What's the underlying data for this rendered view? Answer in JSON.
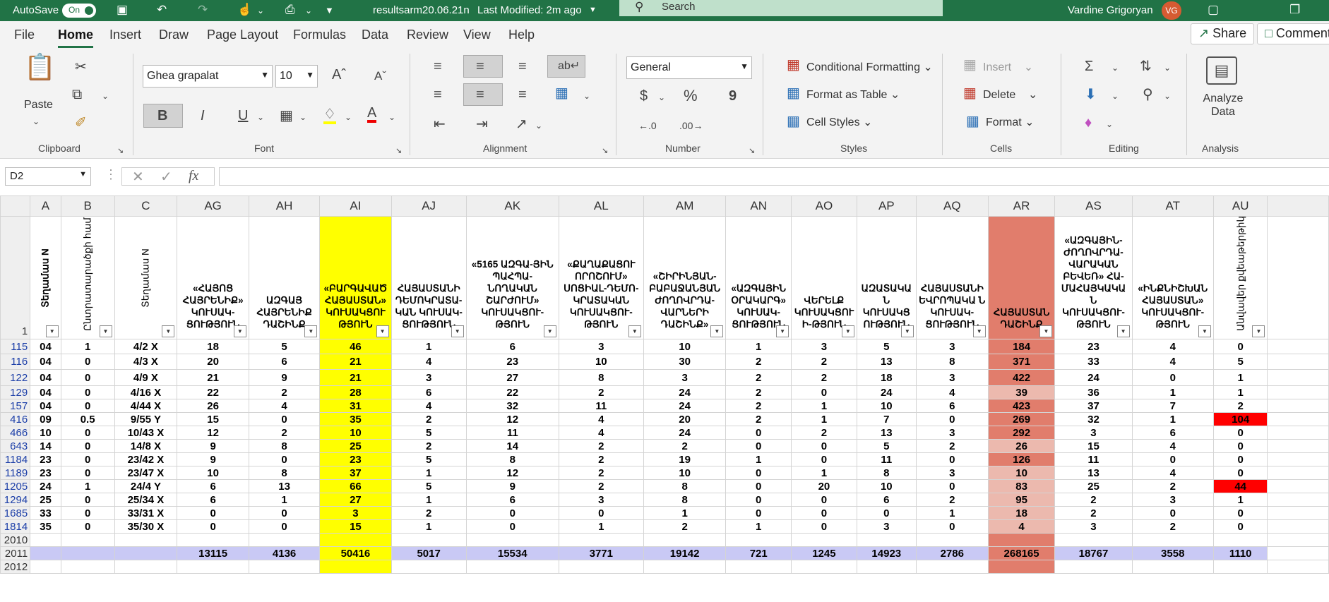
{
  "titlebar": {
    "autosave_label": "AutoSave",
    "toggle_label": "On",
    "filename": "resultsarm20.06.21n",
    "modified": "Last Modified: 2m ago",
    "search_placeholder": "Search",
    "user_name": "Vardine Grigoryan",
    "user_initials": "VG"
  },
  "menu": {
    "tabs": [
      "File",
      "Home",
      "Insert",
      "Draw",
      "Page Layout",
      "Formulas",
      "Data",
      "Review",
      "View",
      "Help"
    ],
    "share": "Share",
    "comments": "Comments"
  },
  "ribbon": {
    "clipboard": {
      "label": "Clipboard",
      "paste": "Paste"
    },
    "font": {
      "label": "Font",
      "name": "Ghea grapalat",
      "size": "10",
      "bold": "B",
      "italic": "I",
      "underline": "U"
    },
    "alignment": {
      "label": "Alignment"
    },
    "number": {
      "label": "Number",
      "format": "General",
      "currency": "$",
      "percent": "%",
      "comma": "9"
    },
    "styles": {
      "label": "Styles",
      "conditional": "Conditional Formatting",
      "table": "Format as Table",
      "cell": "Cell Styles"
    },
    "cells": {
      "label": "Cells",
      "insert": "Insert",
      "delete": "Delete",
      "format": "Format"
    },
    "editing": {
      "label": "Editing"
    },
    "analysis": {
      "label": "Analysis",
      "analyze": "Analyze Data"
    }
  },
  "formula_bar": {
    "name_box": "D2",
    "fx": "fx",
    "value": ""
  },
  "sheet": {
    "columns": [
      "A",
      "B",
      "C",
      "AG",
      "AH",
      "AI",
      "AJ",
      "AK",
      "AL",
      "AM",
      "AN",
      "AO",
      "AP",
      "AQ",
      "AR",
      "AS",
      "AT",
      "AU"
    ],
    "header_row_number": "1",
    "headers": [
      "Տեղամաս N",
      "Ընտրատարածքի համարը",
      "Տեղամաս N",
      "«ՀԱՅՈՑ ՀԱՅՐԵՆԻՔ» ԿՈՒՍԱԿ-ՑՈՒԹՅՈՒՆ",
      "ԱԶԳԱՅ ՀԱՅՐԵՆԻՔ ԴԱՇԻՆՔ",
      "«ԲԱՐԳԱՎԱԾ ՀԱՅԱՍՏԱՆ» ԿՈՒՍԱԿՑՈՒ ԹՅՈՒՆ",
      "ՀԱՅԱՍՏԱՆԻ ԴԵՄՈԿՐԱՏԱ-ԿԱՆ ԿՈՒՍԱԿ-ՑՈՒԹՅՈՒՆ",
      "«5165 ԱԶԳԱ-ՅԻՆ ՊԱՀՊԱ-ՆՈՂԱԿԱՆ ՇԱՐԺՈՒՄ» ԿՈՒՍԱԿՑՈՒ-ԹՅՈՒՆ",
      "«ՔԱՂԱՔԱՑՈՒ ՈՐՈՇՈՒՄ» ՍՈՑԻԱԼ-ԴԵՄՈ-ԿՐԱՏԱԿԱՆ ԿՈՒՍԱԿՑՈՒ-ԹՅՈՒՆ",
      "«ՇԻՐԻՆՅԱՆ-ԲԱԲԱՋԱՆՅԱՆ ԺՈՂՈՎՐԴԱ-ՎԱՐՆԵՐԻ ԴԱՇԻՆՔ»",
      "«ԱԶԳԱՅԻՆ ՕՐԱԿԱՐԳ» ԿՈՒՍԱԿ-ՑՈՒԹՅՈՒՆ",
      "ՎԵՐԵԼՔ ԿՈՒՍԱԿՑՈՒ Ի-ԹՅՈՒՆ",
      "ԱԶԱՏԱԿԱ Ն ԿՈՒՍԱԿՑ ՈՒԹՅՈՒՆ",
      "ՀԱՅԱՍՏԱՆԻ ԵՎՐՈՊԱԿԱ Ն ԿՈՒՍԱԿ-ՑՈՒԹՅՈՒՆ",
      "ՀԱՅԱՍՏԱՆ ԴԱՇԻՆՔ",
      "«ԱԶԳԱՅԻՆ-ԺՈՂՈՎՐԴԱ-ՎԱՐԱԿԱՆ ԲԵՎԵՌ» ՀԱ-ՄԱՀԱՅԿԱԿԱ Ն ԿՈՒՍԱԿՑՈՒ-ԹՅՈՒՆ",
      "«ԻՆՔՆԻՇԽԱՆ ՀԱՅԱՍՏԱՆ» ԿՈՒՍԱԿՑՈՒ-ԹՅՈՒՆ",
      "Անվավեր քվեաթերթիկներ"
    ],
    "rows": [
      {
        "n": "115",
        "c": [
          "04",
          "1",
          "4/2 X",
          "18",
          "5",
          "46",
          "1",
          "6",
          "3",
          "10",
          "1",
          "3",
          "5",
          "3",
          "184",
          "23",
          "4",
          "0"
        ]
      },
      {
        "n": "116",
        "c": [
          "04",
          "0",
          "4/3 X",
          "20",
          "6",
          "21",
          "4",
          "23",
          "10",
          "30",
          "2",
          "2",
          "13",
          "8",
          "371",
          "33",
          "4",
          "5"
        ]
      },
      {
        "n": "122",
        "c": [
          "04",
          "0",
          "4/9 X",
          "21",
          "9",
          "21",
          "3",
          "27",
          "8",
          "3",
          "2",
          "2",
          "18",
          "3",
          "422",
          "24",
          "0",
          "1"
        ]
      },
      {
        "n": "129",
        "c": [
          "04",
          "0",
          "4/16 X",
          "22",
          "2",
          "28",
          "6",
          "22",
          "2",
          "24",
          "2",
          "0",
          "24",
          "4",
          "39",
          "36",
          "1",
          "1"
        ]
      },
      {
        "n": "157",
        "c": [
          "04",
          "0",
          "4/44 X",
          "26",
          "4",
          "31",
          "4",
          "32",
          "11",
          "24",
          "2",
          "1",
          "10",
          "6",
          "423",
          "37",
          "7",
          "2"
        ]
      },
      {
        "n": "416",
        "c": [
          "09",
          "0.5",
          "9/55 Y",
          "15",
          "0",
          "35",
          "2",
          "12",
          "4",
          "20",
          "2",
          "1",
          "7",
          "0",
          "269",
          "32",
          "1",
          "104"
        ]
      },
      {
        "n": "466",
        "c": [
          "10",
          "0",
          "10/43 X",
          "12",
          "2",
          "10",
          "5",
          "11",
          "4",
          "24",
          "0",
          "2",
          "13",
          "3",
          "292",
          "3",
          "6",
          "0"
        ]
      },
      {
        "n": "643",
        "c": [
          "14",
          "0",
          "14/8 X",
          "9",
          "8",
          "25",
          "2",
          "14",
          "2",
          "2",
          "0",
          "0",
          "5",
          "2",
          "26",
          "15",
          "4",
          "0"
        ]
      },
      {
        "n": "1184",
        "c": [
          "23",
          "0",
          "23/42 X",
          "9",
          "0",
          "23",
          "5",
          "8",
          "2",
          "19",
          "1",
          "0",
          "11",
          "0",
          "126",
          "11",
          "0",
          "0"
        ]
      },
      {
        "n": "1189",
        "c": [
          "23",
          "0",
          "23/47 X",
          "10",
          "8",
          "37",
          "1",
          "12",
          "2",
          "10",
          "0",
          "1",
          "8",
          "3",
          "10",
          "13",
          "4",
          "0"
        ]
      },
      {
        "n": "1205",
        "c": [
          "24",
          "1",
          "24/4 Y",
          "6",
          "13",
          "66",
          "5",
          "9",
          "2",
          "8",
          "0",
          "20",
          "10",
          "0",
          "83",
          "25",
          "2",
          "44"
        ]
      },
      {
        "n": "1294",
        "c": [
          "25",
          "0",
          "25/34 X",
          "6",
          "1",
          "27",
          "1",
          "6",
          "3",
          "8",
          "0",
          "0",
          "6",
          "2",
          "95",
          "2",
          "3",
          "1"
        ]
      },
      {
        "n": "1685",
        "c": [
          "33",
          "0",
          "33/31 X",
          "0",
          "0",
          "3",
          "2",
          "0",
          "0",
          "1",
          "0",
          "0",
          "0",
          "1",
          "18",
          "2",
          "0",
          "0"
        ]
      },
      {
        "n": "1814",
        "c": [
          "35",
          "0",
          "35/30 X",
          "0",
          "0",
          "15",
          "1",
          "0",
          "1",
          "2",
          "1",
          "0",
          "3",
          "0",
          "4",
          "3",
          "2",
          "0"
        ]
      }
    ],
    "blank_row_number": "2010",
    "total_row_number": "2011",
    "totals": [
      "",
      "",
      "",
      "13115",
      "4136",
      "50416",
      "5017",
      "15534",
      "3771",
      "19142",
      "721",
      "1245",
      "14923",
      "2786",
      "268165",
      "18767",
      "3558",
      "1110"
    ],
    "last_row_number": "2012",
    "colors": {
      "highlight_yellow": "#ffff00",
      "highlight_salmon": "#e17d6c",
      "light_salmon": "#ecb9ae",
      "alert_red": "#ff0000",
      "total_row": "#c9c9f5"
    }
  }
}
